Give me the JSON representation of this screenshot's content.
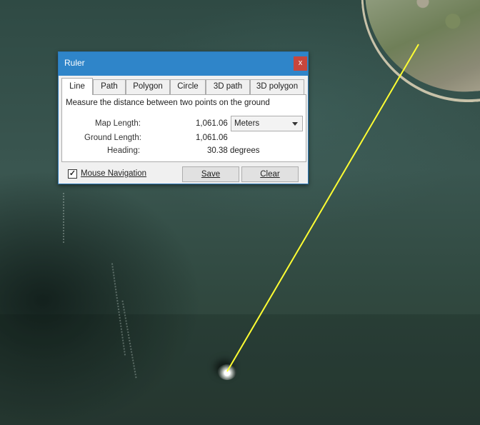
{
  "dialog": {
    "title": "Ruler",
    "close_glyph": "x",
    "tabs": [
      {
        "label": "Line",
        "active": true
      },
      {
        "label": "Path",
        "active": false
      },
      {
        "label": "Polygon",
        "active": false
      },
      {
        "label": "Circle",
        "active": false
      },
      {
        "label": "3D path",
        "active": false
      },
      {
        "label": "3D polygon",
        "active": false
      }
    ],
    "description": "Measure the distance between two points on the ground",
    "map_length": {
      "label": "Map Length:",
      "value": "1,061.06"
    },
    "unit_select": {
      "selected": "Meters",
      "icon": "chevron-down-icon"
    },
    "ground_length": {
      "label": "Ground Length:",
      "value": "1,061.06"
    },
    "heading": {
      "label": "Heading:",
      "value": "30.38 degrees"
    },
    "mouse_navigation": {
      "label": "Mouse Navigation",
      "checked": true,
      "check_glyph": "✓"
    },
    "save_label": "Save",
    "clear_label": "Clear"
  },
  "colors": {
    "titlebar": "#2f85c9",
    "close_button": "#c8463c",
    "measure_line": "#ffff33"
  }
}
